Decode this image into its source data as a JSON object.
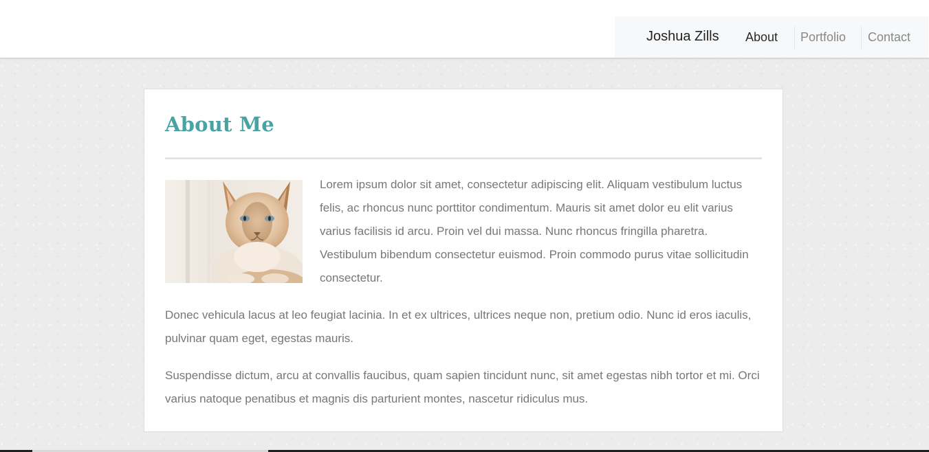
{
  "header": {
    "brand": "Joshua Zills",
    "nav": [
      {
        "label": "About",
        "active": true
      },
      {
        "label": "Portfolio",
        "active": false
      },
      {
        "label": "Contact",
        "active": false
      }
    ]
  },
  "main": {
    "title": "About Me",
    "title_color": "#4aa3a3",
    "image_subject": "cat-photo",
    "paragraphs": [
      "Lorem ipsum dolor sit amet, consectetur adipiscing elit. Aliquam vestibulum luctus felis, ac rhoncus nunc porttitor condimentum. Mauris sit amet dolor eu elit varius varius facilisis id arcu. Proin vel dui massa. Nunc rhoncus fringilla pharetra. Vestibulum bibendum consectetur euismod. Proin commodo purus vitae sollicitudin consectetur.",
      "Donec vehicula lacus at leo feugiat lacinia. In et ex ultrices, ultrices neque non, pretium odio. Nunc id eros iaculis, pulvinar quam eget, egestas mauris.",
      "Suspendisse dictum, arcu at convallis faucibus, quam sapien tincidunt nunc, sit amet egestas nibh tortor et mi. Orci varius natoque penatibus et magnis dis parturient montes, nascetur ridiculus mus."
    ]
  }
}
